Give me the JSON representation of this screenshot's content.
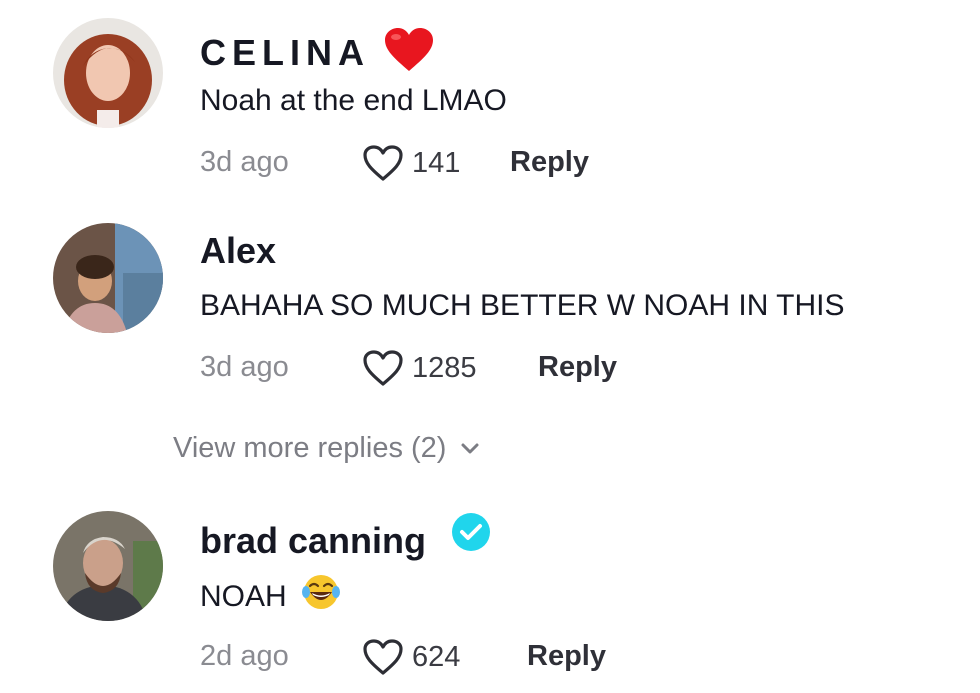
{
  "comments": [
    {
      "username": "CELINA",
      "badge_icon": "red-heart-emoji",
      "text": "Noah at the end LMAO",
      "time": "3d ago",
      "likes": "141",
      "reply_label": "Reply"
    },
    {
      "username": "Alex",
      "text": "BAHAHA SO MUCH BETTER W NOAH IN THIS",
      "time": "3d ago",
      "likes": "1285",
      "reply_label": "Reply"
    },
    {
      "username": "brad canning",
      "badge_icon": "verified-badge-icon",
      "text": "NOAH",
      "text_emoji": "tears-of-joy-emoji",
      "time": "2d ago",
      "likes": "624",
      "reply_label": "Reply"
    }
  ],
  "view_more_replies": "View more replies (2)",
  "colors": {
    "text": "#161823",
    "muted": "#8a8b91",
    "verified": "#20d5ec",
    "heart": "#e8161f"
  }
}
